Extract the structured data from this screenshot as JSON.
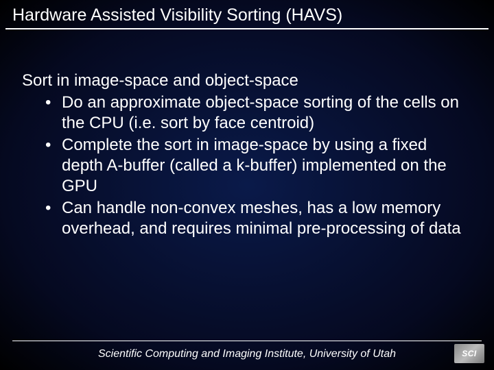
{
  "title": "Hardware Assisted Visibility Sorting (HAVS)",
  "lead": "Sort in image-space and object-space",
  "bullets": [
    "Do an approximate object-space sorting of the cells on the CPU (i.e. sort by face centroid)",
    "Complete the sort in image-space by using a fixed depth A-buffer (called a      k-buffer) implemented on the GPU",
    "Can handle non-convex meshes, has a low memory overhead, and requires minimal pre-processing of data"
  ],
  "footer": "Scientific Computing and Imaging Institute, University of Utah",
  "logo": "SCI"
}
